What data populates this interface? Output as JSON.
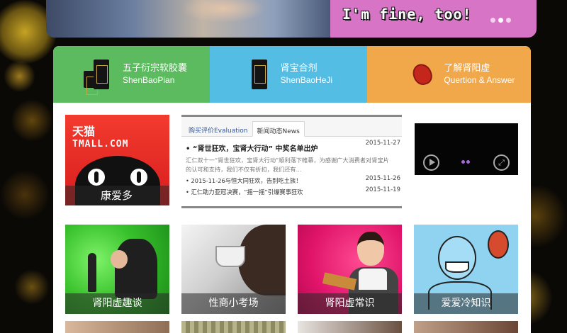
{
  "banner": {
    "slogan": "I'm fine, too!",
    "slide_dots": 3,
    "active_slide": 2
  },
  "nav": [
    {
      "cn": "五子衍宗软胶囊",
      "en": "ShenBaoPian",
      "color": "#5cbb5e",
      "icon": "product-box-icon"
    },
    {
      "cn": "肾宝合剂",
      "en": "ShenBaoHeJi",
      "color": "#54bde3",
      "icon": "product-box-icon"
    },
    {
      "cn": "了解肾阳虚",
      "en": "Quertion & Answer",
      "color": "#f0a84a",
      "icon": "bean-icon"
    }
  ],
  "tmall": {
    "brand_cn": "天猫",
    "brand_en": "TMALL.COM",
    "caption": "康爱多"
  },
  "news": {
    "tabs": [
      {
        "label": "购买评价Evaluation",
        "active": false
      },
      {
        "label": "新闻动态News",
        "active": true
      }
    ],
    "feature": {
      "title": "“肾世狂欢，宝肾大行动” 中奖名单出炉",
      "date": "2015-11-27",
      "excerpt": "汇仁双十一“肾世狂欢，宝肾大行动”顺利落下帷幕，为感谢广大消费者对肾宝片的认可和支持，我们不仅有折扣，我们还有..."
    },
    "items": [
      {
        "title": "2015-11-26与恒大同狂欢，告别吃土族！",
        "date": "2015-11-26"
      },
      {
        "title": "汇仁助力亚冠决赛，“摇一摇”引爆赛事狂欢",
        "date": "2015-11-19"
      }
    ]
  },
  "thumbnails": [
    {
      "caption": "肾阳虚趣谈"
    },
    {
      "caption": "性商小考场"
    },
    {
      "caption": "肾阳虚常识"
    },
    {
      "caption": "爱爱冷知识"
    }
  ]
}
